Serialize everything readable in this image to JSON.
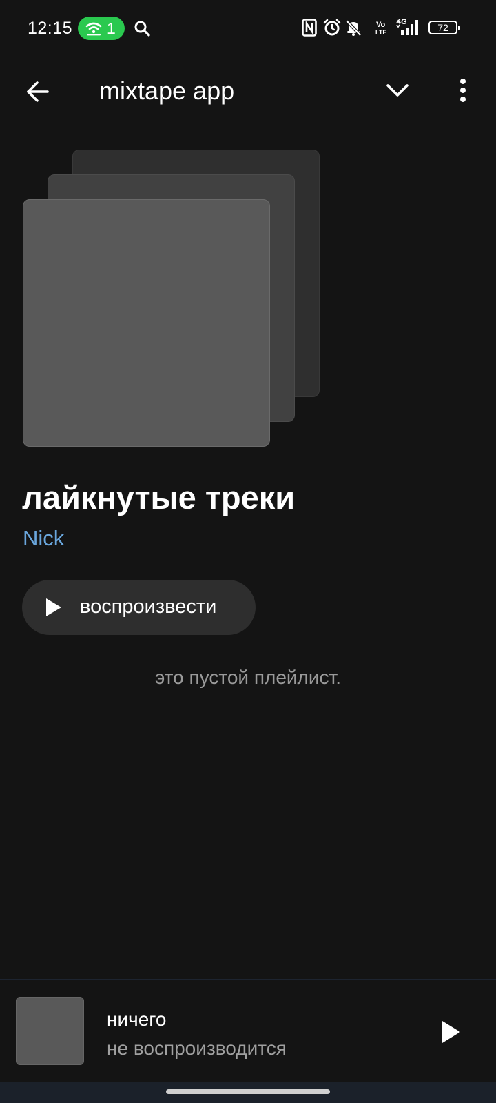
{
  "status_bar": {
    "time": "12:15",
    "hotspot_count": "1",
    "volte_top": "Vo",
    "volte_bottom": "LTE",
    "network": "4G",
    "battery": "72"
  },
  "app_bar": {
    "title": "mixtape app"
  },
  "playlist": {
    "title": "лайкнутые треки",
    "owner": "Nick",
    "play_label": "воспроизвести",
    "empty_message": "это пустой плейлист."
  },
  "mini_player": {
    "title": "ничего",
    "subtitle": "не воспроизводится"
  },
  "colors": {
    "background": "#141414",
    "accent_owner": "#6aa6dc",
    "hotspot_green": "#2ac94f"
  },
  "icons": {
    "back": "arrow-left-icon",
    "collapse": "chevron-down-icon",
    "menu": "more-vertical-icon",
    "play": "play-icon",
    "search": "search-icon"
  }
}
